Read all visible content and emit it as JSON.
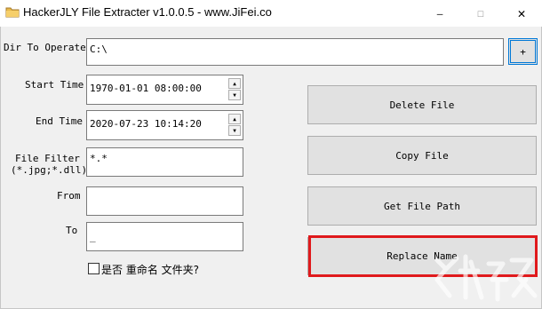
{
  "window": {
    "title": "HackerJLY File Extracter v1.0.0.5 - www.JiFei.co",
    "min_glyph": "—",
    "max_glyph": "☐",
    "close_glyph": "✕"
  },
  "form": {
    "dir": {
      "label": "Dir To Operate",
      "value": "C:\\",
      "browse_label": "+"
    },
    "start_time": {
      "label": "Start Time",
      "value": "1970-01-01 08:00:00"
    },
    "end_time": {
      "label": "End Time",
      "value": "2020-07-23 10:14:20"
    },
    "file_filter": {
      "label_line1": "File Filter",
      "label_line2": "(*.jpg;*.dll)",
      "value": "*.*"
    },
    "from": {
      "label": "From",
      "value": ""
    },
    "to": {
      "label": "To",
      "value": "_"
    },
    "rename_folder_checkbox": {
      "label": "是否 重命名 文件夹?",
      "checked": false
    }
  },
  "actions": {
    "delete_file": "Delete File",
    "copy_file": "Copy File",
    "get_file_path": "Get File Path",
    "replace_name": "Replace Name"
  },
  "spin": {
    "up_glyph": "▲",
    "down_glyph": "▼"
  },
  "colors": {
    "highlight": "#e0191c",
    "focus_border": "#0078d7"
  }
}
